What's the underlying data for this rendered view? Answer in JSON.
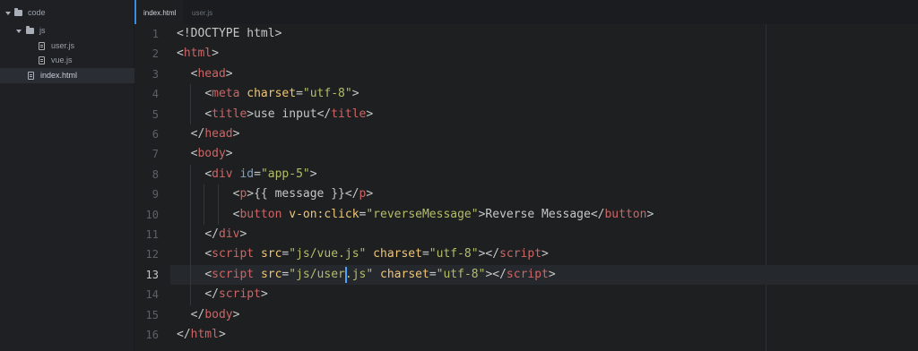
{
  "sidebar": {
    "items": [
      {
        "label": "code",
        "kind": "folder",
        "expanded": true,
        "depth": 0
      },
      {
        "label": "js",
        "kind": "folder",
        "expanded": true,
        "depth": 1
      },
      {
        "label": "user.js",
        "kind": "file",
        "depth": 2
      },
      {
        "label": "vue.js",
        "kind": "file",
        "depth": 2
      },
      {
        "label": "index.html",
        "kind": "file",
        "depth": 1,
        "selected": true
      }
    ]
  },
  "tabs": [
    {
      "label": "index.html",
      "active": true
    },
    {
      "label": "user.js",
      "active": false
    }
  ],
  "editor": {
    "current_line": 13,
    "colors": {
      "tag": "#cc6666",
      "attribute": "#f0c674",
      "id_attribute": "#81a2be",
      "string": "#b5bd68",
      "text": "#c5c8c6",
      "cursor": "#4aa3ff"
    },
    "lines": [
      {
        "n": "1",
        "indent": 0,
        "tokens": [
          {
            "t": "<!DOCTYPE html>",
            "c": "text"
          }
        ]
      },
      {
        "n": "2",
        "indent": 0,
        "tokens": [
          {
            "t": "<",
            "c": "punc"
          },
          {
            "t": "html",
            "c": "tag"
          },
          {
            "t": ">",
            "c": "punc"
          }
        ]
      },
      {
        "n": "3",
        "indent": 1,
        "tokens": [
          {
            "t": "<",
            "c": "punc"
          },
          {
            "t": "head",
            "c": "tag"
          },
          {
            "t": ">",
            "c": "punc"
          }
        ]
      },
      {
        "n": "4",
        "indent": 2,
        "tokens": [
          {
            "t": "<",
            "c": "punc"
          },
          {
            "t": "meta",
            "c": "tag"
          },
          {
            "t": " ",
            "c": "punc"
          },
          {
            "t": "charset",
            "c": "attr"
          },
          {
            "t": "=",
            "c": "punc"
          },
          {
            "t": "\"utf-8\"",
            "c": "str"
          },
          {
            "t": ">",
            "c": "punc"
          }
        ]
      },
      {
        "n": "5",
        "indent": 2,
        "tokens": [
          {
            "t": "<",
            "c": "punc"
          },
          {
            "t": "title",
            "c": "tag"
          },
          {
            "t": ">",
            "c": "punc"
          },
          {
            "t": "use input",
            "c": "text"
          },
          {
            "t": "</",
            "c": "punc"
          },
          {
            "t": "title",
            "c": "tag"
          },
          {
            "t": ">",
            "c": "punc"
          }
        ]
      },
      {
        "n": "6",
        "indent": 1,
        "tokens": [
          {
            "t": "</",
            "c": "punc"
          },
          {
            "t": "head",
            "c": "tag"
          },
          {
            "t": ">",
            "c": "punc"
          }
        ]
      },
      {
        "n": "7",
        "indent": 1,
        "tokens": [
          {
            "t": "<",
            "c": "punc"
          },
          {
            "t": "body",
            "c": "tag"
          },
          {
            "t": ">",
            "c": "punc"
          }
        ]
      },
      {
        "n": "8",
        "indent": 2,
        "tokens": [
          {
            "t": "<",
            "c": "punc"
          },
          {
            "t": "div",
            "c": "tag"
          },
          {
            "t": " ",
            "c": "punc"
          },
          {
            "t": "id",
            "c": "id"
          },
          {
            "t": "=",
            "c": "punc"
          },
          {
            "t": "\"app-5\"",
            "c": "str"
          },
          {
            "t": ">",
            "c": "punc"
          }
        ]
      },
      {
        "n": "9",
        "indent": 4,
        "tokens": [
          {
            "t": "<",
            "c": "punc"
          },
          {
            "t": "p",
            "c": "tag"
          },
          {
            "t": ">",
            "c": "punc"
          },
          {
            "t": "{{ message }}",
            "c": "text"
          },
          {
            "t": "</",
            "c": "punc"
          },
          {
            "t": "p",
            "c": "tag"
          },
          {
            "t": ">",
            "c": "punc"
          }
        ]
      },
      {
        "n": "10",
        "indent": 4,
        "tokens": [
          {
            "t": "<",
            "c": "punc"
          },
          {
            "t": "button",
            "c": "tag"
          },
          {
            "t": " ",
            "c": "punc"
          },
          {
            "t": "v-on:click",
            "c": "attr"
          },
          {
            "t": "=",
            "c": "punc"
          },
          {
            "t": "\"reverseMessage\"",
            "c": "str"
          },
          {
            "t": ">",
            "c": "punc"
          },
          {
            "t": "Reverse Message",
            "c": "text"
          },
          {
            "t": "</",
            "c": "punc"
          },
          {
            "t": "button",
            "c": "tag"
          },
          {
            "t": ">",
            "c": "punc"
          }
        ]
      },
      {
        "n": "11",
        "indent": 2,
        "tokens": [
          {
            "t": "</",
            "c": "punc"
          },
          {
            "t": "div",
            "c": "tag"
          },
          {
            "t": ">",
            "c": "punc"
          }
        ]
      },
      {
        "n": "12",
        "indent": 2,
        "tokens": [
          {
            "t": "<",
            "c": "punc"
          },
          {
            "t": "script",
            "c": "tag"
          },
          {
            "t": " ",
            "c": "punc"
          },
          {
            "t": "src",
            "c": "attr"
          },
          {
            "t": "=",
            "c": "punc"
          },
          {
            "t": "\"js/vue.js\"",
            "c": "str"
          },
          {
            "t": " ",
            "c": "punc"
          },
          {
            "t": "charset",
            "c": "attr"
          },
          {
            "t": "=",
            "c": "punc"
          },
          {
            "t": "\"utf-8\"",
            "c": "str"
          },
          {
            "t": "></",
            "c": "punc"
          },
          {
            "t": "script",
            "c": "tag"
          },
          {
            "t": ">",
            "c": "punc"
          }
        ]
      },
      {
        "n": "13",
        "indent": 2,
        "tokens": [
          {
            "t": "<",
            "c": "punc"
          },
          {
            "t": "script",
            "c": "tag"
          },
          {
            "t": " ",
            "c": "punc"
          },
          {
            "t": "src",
            "c": "attr"
          },
          {
            "t": "=",
            "c": "punc"
          },
          {
            "t": "\"js/user",
            "c": "str"
          },
          {
            "t": ".js\"",
            "c": "str"
          },
          {
            "t": " ",
            "c": "punc"
          },
          {
            "t": "charset",
            "c": "attr"
          },
          {
            "t": "=",
            "c": "punc"
          },
          {
            "t": "\"utf-8\"",
            "c": "str"
          },
          {
            "t": "></",
            "c": "punc"
          },
          {
            "t": "script",
            "c": "tag"
          },
          {
            "t": ">",
            "c": "punc"
          }
        ]
      },
      {
        "n": "14",
        "indent": 2,
        "tokens": [
          {
            "t": "</",
            "c": "punc"
          },
          {
            "t": "script",
            "c": "tag"
          },
          {
            "t": ">",
            "c": "punc"
          }
        ]
      },
      {
        "n": "15",
        "indent": 1,
        "tokens": [
          {
            "t": "</",
            "c": "punc"
          },
          {
            "t": "body",
            "c": "tag"
          },
          {
            "t": ">",
            "c": "punc"
          }
        ]
      },
      {
        "n": "16",
        "indent": 0,
        "tokens": [
          {
            "t": "</",
            "c": "punc"
          },
          {
            "t": "html",
            "c": "tag"
          },
          {
            "t": ">",
            "c": "punc"
          }
        ]
      }
    ]
  }
}
